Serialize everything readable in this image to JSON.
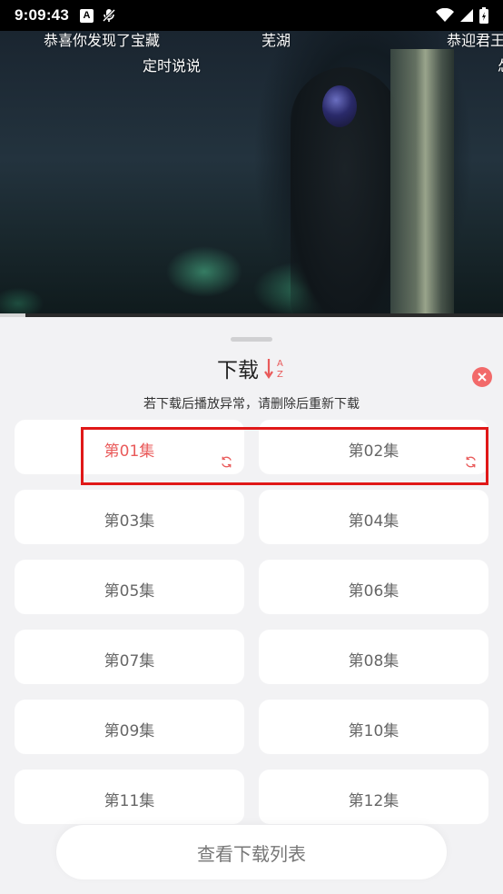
{
  "status_bar": {
    "time": "9:09:43",
    "a_badge": "A"
  },
  "video": {
    "danmaku": [
      "恭喜你发现了宝藏",
      "芜湖",
      "恭迎君王",
      "定时说说",
      "怂"
    ],
    "progress_fraction": 0.05
  },
  "sheet": {
    "title": "下载",
    "sort_icon": "sort-az-icon",
    "close_icon": "close-icon",
    "hint": "若下载后播放异常，请删除后重新下载",
    "episodes": [
      {
        "label": "第01集",
        "active": true,
        "status_icon": "downloading-icon"
      },
      {
        "label": "第02集",
        "active": false,
        "status_icon": "downloading-icon"
      },
      {
        "label": "第03集",
        "active": false
      },
      {
        "label": "第04集",
        "active": false
      },
      {
        "label": "第05集",
        "active": false
      },
      {
        "label": "第06集",
        "active": false
      },
      {
        "label": "第07集",
        "active": false
      },
      {
        "label": "第08集",
        "active": false
      },
      {
        "label": "第09集",
        "active": false
      },
      {
        "label": "第10集",
        "active": false
      },
      {
        "label": "第11集",
        "active": false
      },
      {
        "label": "第12集",
        "active": false
      }
    ],
    "view_list_label": "查看下载列表"
  },
  "colors": {
    "accent": "#e95a5a",
    "close_button": "#f26a6a",
    "highlight_box": "#e01818"
  }
}
